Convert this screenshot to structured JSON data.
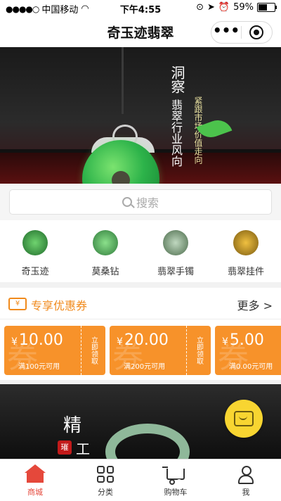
{
  "status": {
    "signal_dots": "●●●●○",
    "carrier": "中国移动",
    "wifi": "wifi-icon",
    "time": "下午4:55",
    "battery_pct": "59%",
    "battery_level": 0.59
  },
  "nav": {
    "title": "奇玉迹翡翠",
    "more_icon": "more-icon",
    "close_icon": "close-icon"
  },
  "banner": {
    "headline": "洞察",
    "subline": "翡翠行业风向",
    "tagline": "紧跟市场价值走向"
  },
  "search": {
    "placeholder": "搜索"
  },
  "categories": [
    {
      "label": "奇玉迹",
      "color": "#2e8a3a"
    },
    {
      "label": "莫桑钻",
      "color": "#3a9a4a"
    },
    {
      "label": "翡翠手镯",
      "color": "#6a8a6a"
    },
    {
      "label": "翡翠挂件",
      "color": "#b08a2a"
    }
  ],
  "coupon_section": {
    "ticket_symbol": "¥",
    "title": "专享优惠券",
    "more": "更多 >"
  },
  "coupons": [
    {
      "symbol": "¥",
      "amount": "10.00",
      "condition": "满100元可用",
      "claim": "立即领取",
      "watermark": "券"
    },
    {
      "symbol": "¥",
      "amount": "20.00",
      "condition": "满200元可用",
      "claim": "立即领取",
      "watermark": "券"
    },
    {
      "symbol": "¥",
      "amount": "5.00",
      "condition": "满0.00元可用",
      "claim": "",
      "watermark": "券"
    }
  ],
  "promo": {
    "char1": "精",
    "char2": "工",
    "seal": "璀"
  },
  "tabs": [
    {
      "label": "商城",
      "active": true
    },
    {
      "label": "分类"
    },
    {
      "label": "购物车"
    },
    {
      "label": "我"
    }
  ],
  "colors": {
    "accent": "#e5483b",
    "coupon": "#f7922a",
    "coupon_title": "#f08a1c",
    "chat": "#f8d531"
  }
}
